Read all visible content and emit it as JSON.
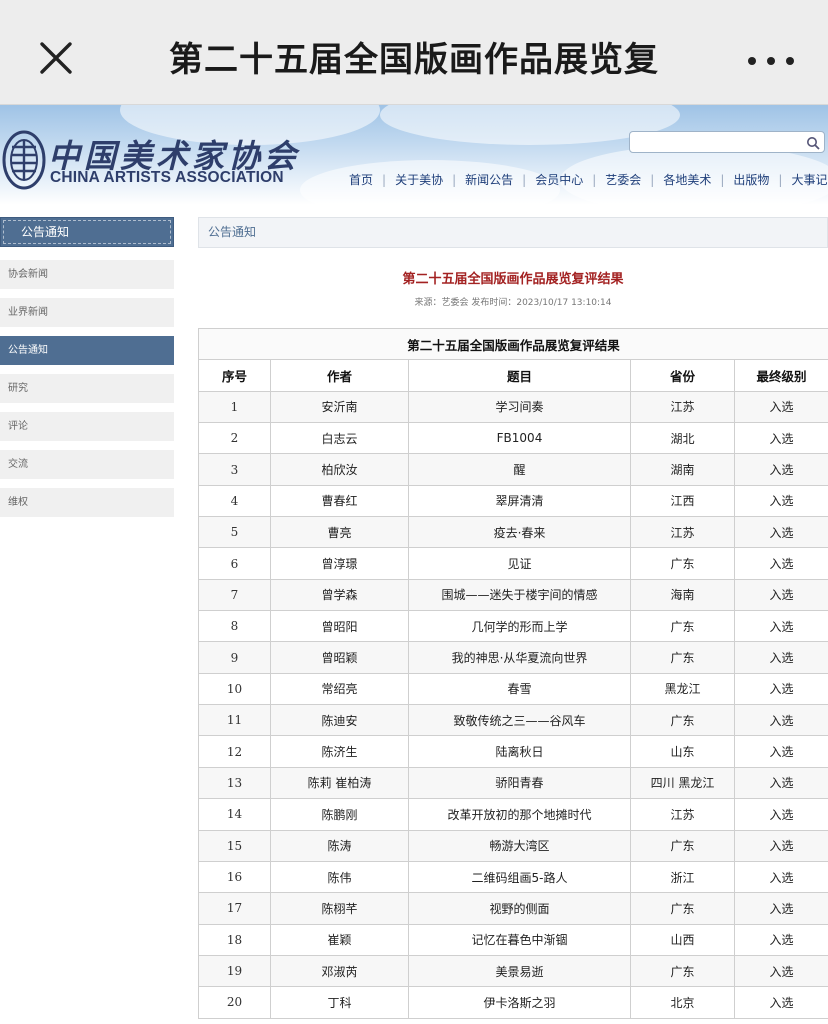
{
  "appbar": {
    "title": "第二十五届全国版画作品展览复",
    "close_icon": "close-icon",
    "more_icon": "more-icon"
  },
  "header": {
    "logo_cn": "中国美术家协会",
    "logo_en": "CHINA ARTISTS ASSOCIATION",
    "search_placeholder": "",
    "nav": [
      "首页",
      "关于美协",
      "新闻公告",
      "会员中心",
      "艺委会",
      "各地美术",
      "出版物",
      "大事记"
    ]
  },
  "sidebar": {
    "heading": "公告通知",
    "items": [
      {
        "label": "协会新闻",
        "active": false
      },
      {
        "label": "业界新闻",
        "active": false
      },
      {
        "label": "公告通知",
        "active": true
      },
      {
        "label": "研究",
        "active": false
      },
      {
        "label": "评论",
        "active": false
      },
      {
        "label": "交流",
        "active": false
      },
      {
        "label": "维权",
        "active": false
      }
    ]
  },
  "main": {
    "breadcrumb": "公告通知",
    "article_title": "第二十五届全国版画作品展览复评结果",
    "article_meta": "来源：艺委会 发布时间：2023/10/17 13:10:14",
    "table": {
      "caption": "第二十五届全国版画作品展览复评结果",
      "columns": [
        "序号",
        "作者",
        "题目",
        "省份",
        "最终级别"
      ],
      "rows": [
        [
          "1",
          "安沂南",
          "学习间奏",
          "江苏",
          "入选"
        ],
        [
          "2",
          "白志云",
          "FB1004",
          "湖北",
          "入选"
        ],
        [
          "3",
          "柏欣汝",
          "醒",
          "湖南",
          "入选"
        ],
        [
          "4",
          "曹春红",
          "翠屏清清",
          "江西",
          "入选"
        ],
        [
          "5",
          "曹亮",
          "疫去·春来",
          "江苏",
          "入选"
        ],
        [
          "6",
          "曾淳璟",
          "见证",
          "广东",
          "入选"
        ],
        [
          "7",
          "曾学森",
          "围城——迷失于楼宇间的情感",
          "海南",
          "入选"
        ],
        [
          "8",
          "曾昭阳",
          "几何学的形而上学",
          "广东",
          "入选"
        ],
        [
          "9",
          "曾昭颖",
          "我的神思·从华夏流向世界",
          "广东",
          "入选"
        ],
        [
          "10",
          "常绍亮",
          "春雪",
          "黑龙江",
          "入选"
        ],
        [
          "11",
          "陈迪安",
          "致敬传统之三——谷风车",
          "广东",
          "入选"
        ],
        [
          "12",
          "陈济生",
          "陆离秋日",
          "山东",
          "入选"
        ],
        [
          "13",
          "陈莉  崔柏涛",
          "骄阳青春",
          "四川  黑龙江",
          "入选"
        ],
        [
          "14",
          "陈鹏刚",
          "改革开放初的那个地摊时代",
          "江苏",
          "入选"
        ],
        [
          "15",
          "陈涛",
          "畅游大湾区",
          "广东",
          "入选"
        ],
        [
          "16",
          "陈伟",
          "二维码组画5-路人",
          "浙江",
          "入选"
        ],
        [
          "17",
          "陈栩芊",
          "视野的侧面",
          "广东",
          "入选"
        ],
        [
          "18",
          "崔颖",
          "记忆在暮色中渐锢",
          "山西",
          "入选"
        ],
        [
          "19",
          "邓淑芮",
          "美景易逝",
          "广东",
          "入选"
        ],
        [
          "20",
          "丁科",
          "伊卡洛斯之羽",
          "北京",
          "入选"
        ]
      ]
    }
  }
}
